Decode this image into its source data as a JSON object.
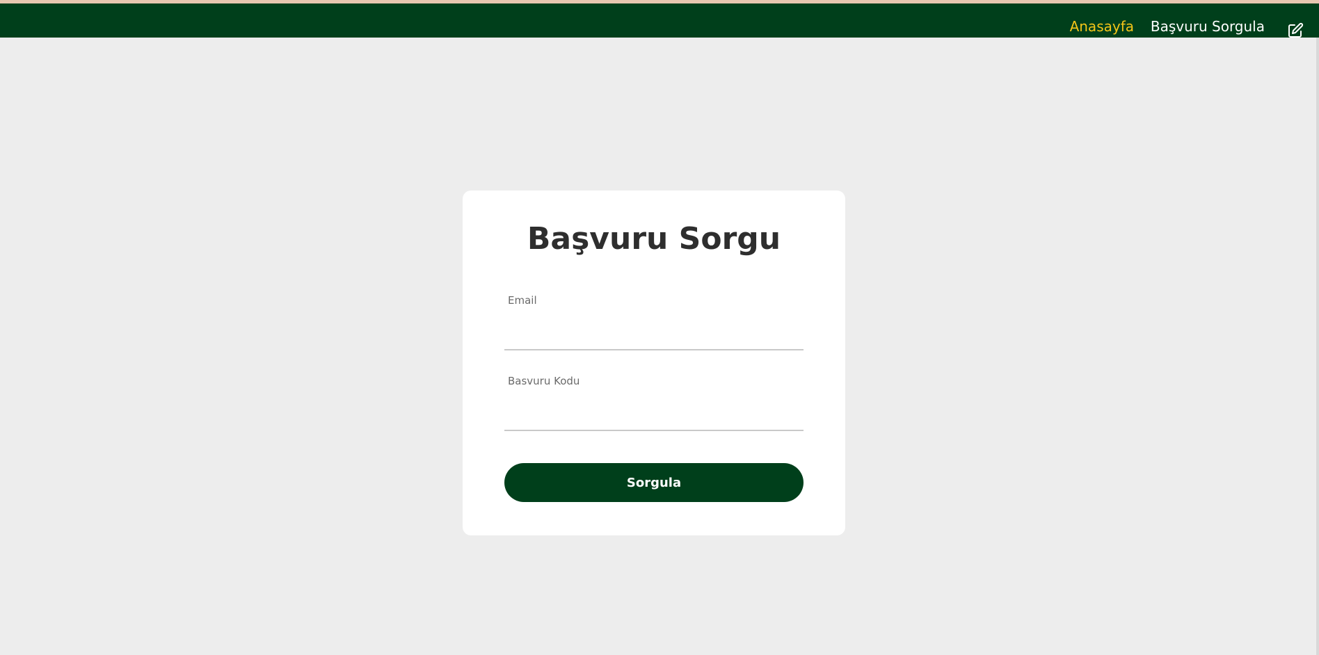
{
  "nav": {
    "home_label": "Anasayfa",
    "query_label": "Başvuru Sorgula",
    "edit_icon": "edit-icon",
    "active_color": "#f5c518",
    "bar_color": "#003f1b"
  },
  "form": {
    "title": "Başvuru Sorgu",
    "email_label": "Email",
    "email_value": "",
    "code_label": "Basvuru Kodu",
    "code_value": "",
    "submit_label": "Sorgula"
  }
}
